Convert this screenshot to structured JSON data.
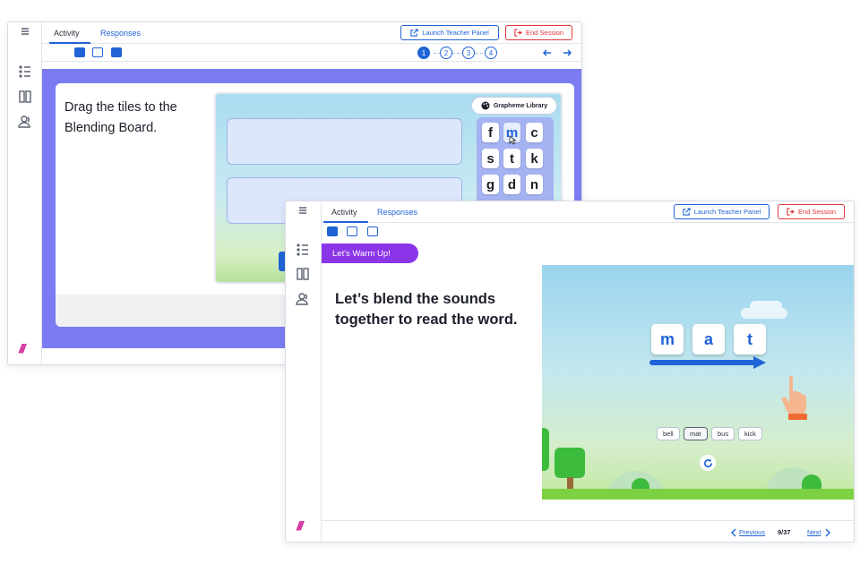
{
  "back_window": {
    "tabs": {
      "activity": "Activity",
      "responses": "Responses"
    },
    "buttons": {
      "launch_teacher_panel": "Launch Teacher Panel",
      "end_session": "End Session"
    },
    "steps": [
      "1",
      "2",
      "3",
      "4"
    ],
    "active_step": "1",
    "instruction": "Drag the tiles to the Blending Board.",
    "grapheme_library_label": "Grapheme Library",
    "graphemes": [
      "f",
      "m",
      "c",
      "s",
      "t",
      "k",
      "g",
      "d",
      "n"
    ],
    "highlighted_grapheme": "m"
  },
  "front_window": {
    "tabs": {
      "activity": "Activity",
      "responses": "Responses"
    },
    "buttons": {
      "launch_teacher_panel": "Launch Teacher Panel",
      "end_session": "End Session"
    },
    "banner": "Let's Warm Up!",
    "instruction": "Let’s blend the sounds together to read the word.",
    "word_tiles": [
      "m",
      "a",
      "t"
    ],
    "word_choices": [
      "bell",
      "mat",
      "bus",
      "kick"
    ],
    "selected_choice": "mat",
    "pagination": {
      "previous": "Previous",
      "page": "9/37",
      "next": "Next"
    }
  },
  "brand_mark": "///",
  "colors": {
    "accent": "#1f63d6",
    "danger": "#e0353a",
    "stage": "#7b7cf1",
    "banner": "#8a35e8",
    "brand": "#d1249a"
  }
}
